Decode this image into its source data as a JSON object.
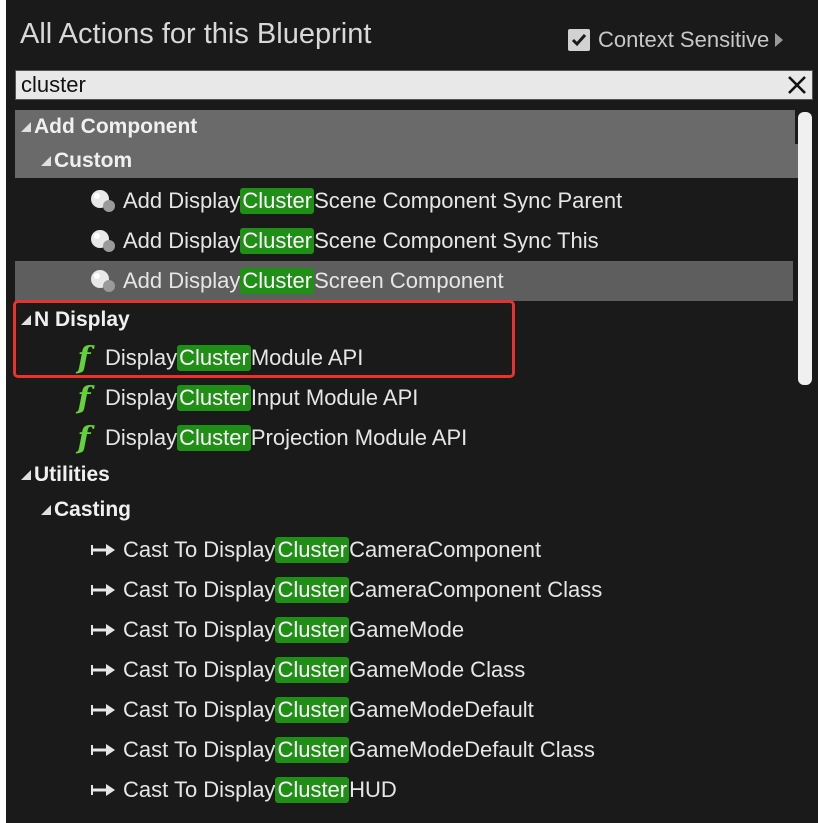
{
  "header": {
    "title": "All Actions for this Blueprint",
    "context_sensitive_label": "Context Sensitive",
    "context_sensitive_checked": true
  },
  "search": {
    "value": "cluster"
  },
  "highlight_word": "Cluster",
  "colors": {
    "highlight": "#1f8f16",
    "function_icon": "#64d23c",
    "annotation_box": "#e8322e"
  },
  "tree": {
    "add_component": "Add Component",
    "custom": "Custom",
    "custom_items": [
      {
        "before": "Add Display ",
        "match": "Cluster",
        "after": " Scene Component Sync Parent",
        "icon": "component-sphere-icon"
      },
      {
        "before": "Add Display ",
        "match": "Cluster",
        "after": " Scene Component Sync This",
        "icon": "component-sphere-icon"
      },
      {
        "before": "Add Display ",
        "match": "Cluster",
        "after": " Screen Component",
        "icon": "component-sphere-icon"
      }
    ],
    "n_display": "N Display",
    "n_display_items": [
      {
        "before": "Display",
        "match": "Cluster",
        "after": " Module API",
        "icon": "function-icon"
      },
      {
        "before": "Display",
        "match": "Cluster",
        "after": "Input Module API",
        "icon": "function-icon"
      },
      {
        "before": "Display",
        "match": "Cluster",
        "after": "Projection Module API",
        "icon": "function-icon"
      }
    ],
    "utilities": "Utilities",
    "casting": "Casting",
    "casting_items": [
      {
        "before": "Cast To Display",
        "match": "Cluster",
        "after": "CameraComponent",
        "icon": "cast-arrow-icon"
      },
      {
        "before": "Cast To Display",
        "match": "Cluster",
        "after": "CameraComponent Class",
        "icon": "cast-arrow-icon"
      },
      {
        "before": "Cast To Display",
        "match": "Cluster",
        "after": "GameMode",
        "icon": "cast-arrow-icon"
      },
      {
        "before": "Cast To Display",
        "match": "Cluster",
        "after": "GameMode Class",
        "icon": "cast-arrow-icon"
      },
      {
        "before": "Cast To Display",
        "match": "Cluster",
        "after": "GameModeDefault",
        "icon": "cast-arrow-icon"
      },
      {
        "before": "Cast To Display",
        "match": "Cluster",
        "after": "GameModeDefault Class",
        "icon": "cast-arrow-icon"
      },
      {
        "before": "Cast To Display",
        "match": "Cluster",
        "after": "HUD",
        "icon": "cast-arrow-icon"
      }
    ]
  }
}
